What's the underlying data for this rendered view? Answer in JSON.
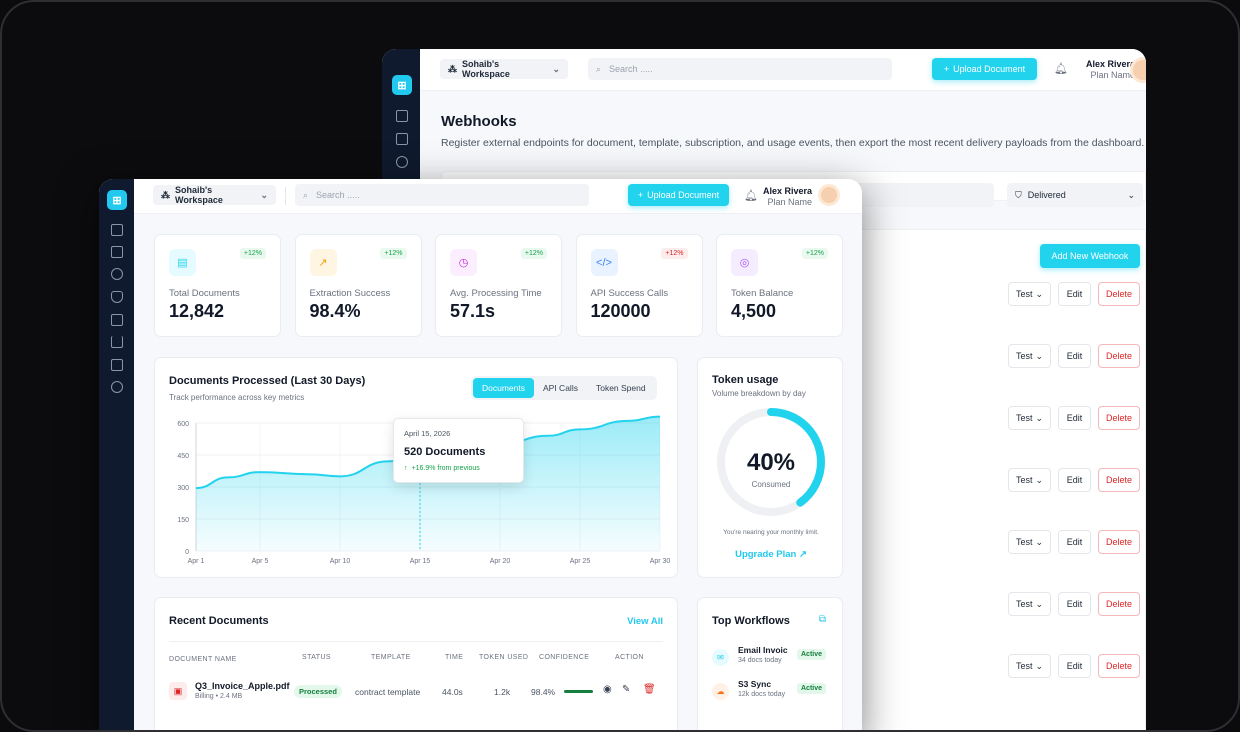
{
  "back": {
    "workspace": "Sohaib's Workspace",
    "search_placeholder": "Search .....",
    "upload_label": "Upload Document",
    "user_name": "Alex Rivera",
    "user_plan": "Plan Name",
    "page_title": "Webhooks",
    "page_desc": "Register external endpoints for document, template, subscription, and usage events, then export the most recent delivery payloads from the dashboard.",
    "filter_value": "Delivered",
    "add_button": "Add New Webhook",
    "row_actions": {
      "test": "Test",
      "edit": "Edit",
      "delete": "Delete"
    },
    "row_count": 7
  },
  "front": {
    "workspace": "Sohaib's Workspace",
    "search_placeholder": "Search .....",
    "upload_label": "Upload Document",
    "user_name": "Alex Rivera",
    "user_plan": "Plan Name",
    "stats": [
      {
        "label": "Total Documents",
        "value": "12,842",
        "badge": "+12%",
        "icon": "document-icon",
        "color": "#22d3ee",
        "bg": "#e6fbff",
        "badge_color": "#16a34a",
        "badge_bg": "#e9f9ef",
        "glyph": "▤"
      },
      {
        "label": "Extraction Success",
        "value": "98.4%",
        "badge": "+12%",
        "icon": "trend-up-icon",
        "color": "#f59e0b",
        "bg": "#fff5e3",
        "badge_color": "#16a34a",
        "badge_bg": "#e9f9ef",
        "glyph": "↗"
      },
      {
        "label": "Avg. Processing Time",
        "value": "57.1s",
        "badge": "+12%",
        "icon": "clock-icon",
        "color": "#c026d3",
        "bg": "#fbeefe",
        "badge_color": "#16a34a",
        "badge_bg": "#e9f9ef",
        "glyph": "◷"
      },
      {
        "label": "API Success Calls",
        "value": "120000",
        "badge": "+12%",
        "icon": "code-icon",
        "color": "#3b82f6",
        "bg": "#e9f2ff",
        "badge_color": "#dc2626",
        "badge_bg": "#fdecec",
        "glyph": "</>"
      },
      {
        "label": "Token Balance",
        "value": "4,500",
        "badge": "+12%",
        "icon": "token-icon",
        "color": "#a855f7",
        "bg": "#f5edff",
        "badge_color": "#16a34a",
        "badge_bg": "#e9f9ef",
        "glyph": "◎"
      }
    ],
    "chart_card": {
      "title": "Documents Processed (Last 30 Days)",
      "subtitle": "Track performance across key metrics",
      "tabs": [
        "Documents",
        "API Calls",
        "Token Spend"
      ],
      "tooltip": {
        "date": "April 15, 2026",
        "value": "520 Documents",
        "change": "+16.9% from previous"
      }
    },
    "token_usage": {
      "title": "Token usage",
      "subtitle": "Volume breakdown by day",
      "percent_label": "40%",
      "percent": 0.4,
      "consumed": "Consumed",
      "note": "You're nearing your monthly limit.",
      "upgrade": "Upgrade Plan ↗"
    },
    "recent": {
      "title": "Recent Documents",
      "view_all": "View All",
      "headers": [
        "DOCUMENT NAME",
        "STATUS",
        "TEMPLATE",
        "TIME",
        "TOKEN USED",
        "CONFIDENCE",
        "ACTION"
      ],
      "rows": [
        {
          "name": "Q3_Invoice_Apple.pdf",
          "meta": "Billing • 2.4 MB",
          "status": "Processed",
          "template": "contract template",
          "time": "44.0s",
          "tokens": "1.2k",
          "confidence": "98.4%",
          "confidence_value": 0.984
        }
      ]
    },
    "workflows": {
      "title": "Top Workflows",
      "items": [
        {
          "name": "Email Invoic",
          "meta": "34 docs today",
          "status": "Active"
        },
        {
          "name": "S3 Sync",
          "meta": "12k docs today",
          "status": "Active"
        }
      ]
    }
  },
  "chart_data": {
    "type": "area",
    "x": [
      "Apr 1",
      "Apr 5",
      "Apr 10",
      "Apr 15",
      "Apr 20",
      "Apr 25",
      "Apr 30"
    ],
    "x_all": [
      1,
      5,
      10,
      15,
      20,
      25,
      30
    ],
    "points": [
      [
        1,
        295
      ],
      [
        3,
        345
      ],
      [
        5,
        370
      ],
      [
        8,
        360
      ],
      [
        10,
        350
      ],
      [
        13,
        420
      ],
      [
        15,
        460
      ],
      [
        17,
        470
      ],
      [
        20,
        500
      ],
      [
        23,
        540
      ],
      [
        25,
        570
      ],
      [
        28,
        610
      ],
      [
        30,
        630
      ]
    ],
    "yticks": [
      0,
      150,
      300,
      450,
      600
    ],
    "ylim": [
      0,
      600
    ],
    "xlim": [
      1,
      30
    ],
    "highlight_x": 15,
    "color": "#22d3ee"
  }
}
